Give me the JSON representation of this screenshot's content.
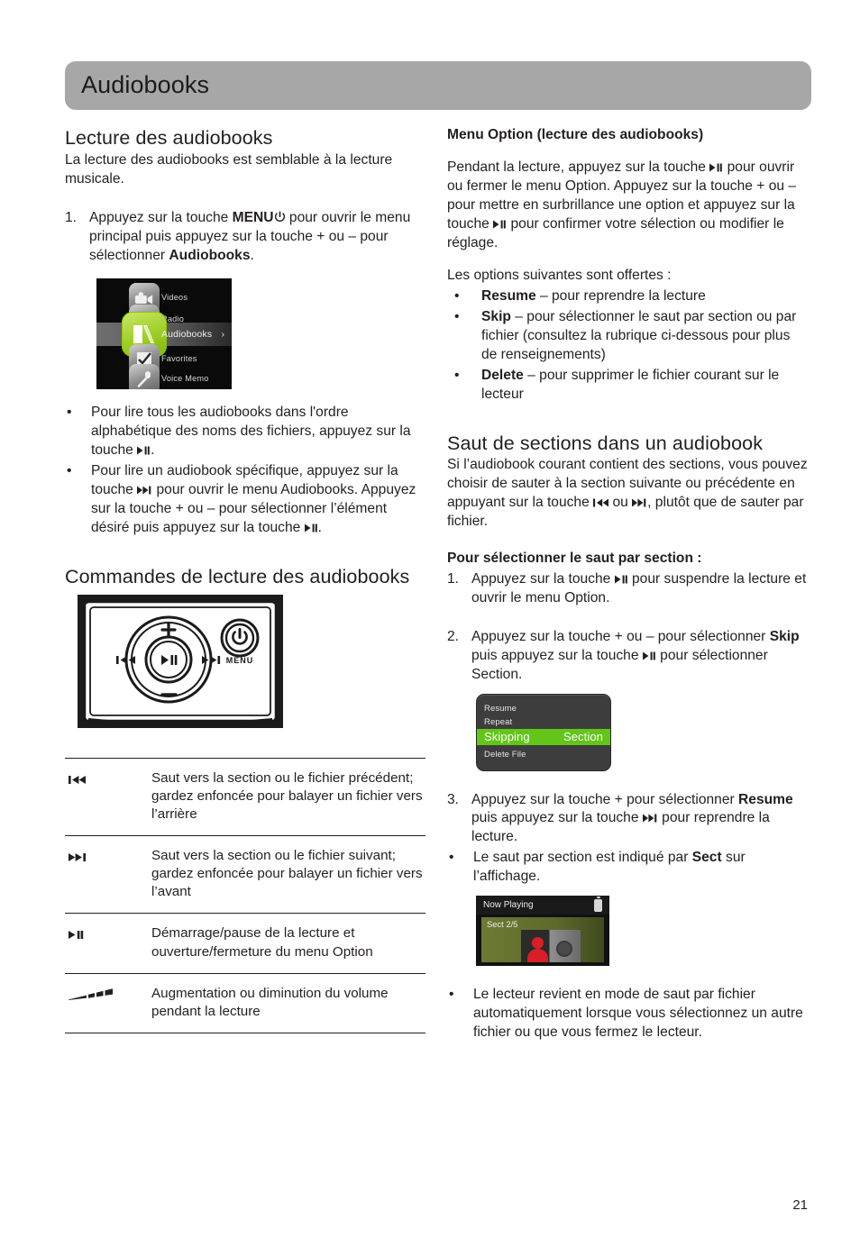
{
  "header": {
    "title": "Audiobooks",
    "bar_color": "#a7a7a7"
  },
  "left_column": {
    "section1": {
      "heading": "Lecture des audiobooks",
      "intro": "La lecture des audiobooks est semblable à la lecture musicale.",
      "step1_num": "1.",
      "step1_a": "Appuyez sur la touche ",
      "step1_menu": "MENU",
      "step1_b": " pour ouvrir le menu principal puis appuyez sur la touche + ou – pour sélectionner ",
      "step1_bold": "Audiobooks",
      "step1_c": ".",
      "bullet1_a": "Pour lire tous les audiobooks dans l'ordre alphabétique des noms des fichiers, appuyez sur la touche ",
      "bullet1_b": ".",
      "bullet2_a": "Pour lire un audiobook spécifique, appuyez sur la touche ",
      "bullet2_b": " pour ouvrir le menu Audiobooks. Appuyez sur la touche + ou – pour sélectionner l’élément désiré puis appuyez sur la touche ",
      "bullet2_c": ".",
      "bullet_mark": "•"
    },
    "device_menu_screenshot": {
      "items": [
        {
          "label": "Videos",
          "selected": false,
          "icon": "camcorder-icon"
        },
        {
          "label": "Radio",
          "selected": false,
          "icon": "radio-icon"
        },
        {
          "label": "Audiobooks",
          "selected": true,
          "icon": "book-icon",
          "chevron": "›"
        },
        {
          "label": "Favorites",
          "selected": false,
          "icon": "checkbox-icon"
        },
        {
          "label": "Voice Memo",
          "selected": false,
          "icon": "microphone-icon"
        }
      ],
      "highlight_color": "#9ccc2e"
    },
    "section2": {
      "heading": "Commandes de lecture des audiobooks",
      "pad_labels": {
        "plus": "+",
        "minus": "–",
        "menu": "MENU"
      },
      "table": [
        {
          "key_icon": "skip-back-icon",
          "desc": "Saut vers la section ou le fichier précédent; gardez enfoncée pour balayer un fichier vers l’arrière"
        },
        {
          "key_icon": "skip-forward-icon",
          "desc": "Saut vers la section ou le fichier suivant; gardez enfoncée pour balayer un fichier vers l’avant"
        },
        {
          "key_icon": "play-pause-icon",
          "desc": "Démarrage/pause de la lecture et ouverture/fermeture du menu Option"
        },
        {
          "key_icon": "volume-icon",
          "desc": "Augmentation ou diminution du volume pendant la lecture"
        }
      ]
    }
  },
  "right_column": {
    "option_menu": {
      "heading": "Menu Option (lecture des audiobooks)",
      "para_a": "Pendant la lecture, appuyez sur la touche ",
      "para_b": " pour ouvrir ou fermer le menu Option. Appuyez sur la touche + ou – pour mettre en surbrillance une option et appuyez sur la touche ",
      "para_c": " pour confirmer votre sélection ou modifier le réglage.",
      "options_intro": "Les options suivantes sont offertes :",
      "bullet_mark": "•",
      "options": [
        {
          "name": "Resume",
          "desc": " – pour reprendre la lecture"
        },
        {
          "name": "Skip ",
          "desc": " – pour sélectionner le saut par section ou par fichier (consultez la rubrique ci-dessous pour plus de renseignements)"
        },
        {
          "name": "Delete",
          "desc": " – pour supprimer le fichier courant sur le lecteur"
        }
      ]
    },
    "section_skip": {
      "heading": "Saut de sections dans un audiobook",
      "para_a": "Si l’audiobook courant contient des sections, vous pouvez choisir de sauter à la section suivante ou précédente en appuyant sur la touche ",
      "para_mid": " ou ",
      "para_c": ", plutôt que de sauter par fichier.",
      "sub_heading": "Pour sélectionner le saut par section :",
      "step1_num": "1.",
      "step1_a": "Appuyez sur la touche ",
      "step1_b": " pour suspendre la lecture et ouvrir le menu Option.",
      "step2_num": "2.",
      "step2_a": "Appuyez sur la touche + ou – pour sélectionner ",
      "step2_bold": "Skip",
      "step2_b": " puis appuyez sur la touche ",
      "step2_c": " pour sélectionner Section.",
      "step3_num": "3.",
      "step3_a": "Appuyez sur la touche + pour sélectionner ",
      "step3_bold": "Resume",
      "step3_b": " puis appuyez sur la touche ",
      "step3_c": "  pour reprendre la lecture.",
      "bullet_mark": "•",
      "bullet1_a": "Le saut par section est indiqué par ",
      "bullet1_bold": "Sect",
      "bullet1_b": " sur l’affichage.",
      "bullet2": "Le lecteur revient en mode de saut par fichier automatiquement lorsque vous sélectionnez un autre fichier ou que vous fermez le lecteur."
    },
    "option_screenshot": {
      "rows": [
        {
          "label": "Resume",
          "value": "",
          "highlighted": false
        },
        {
          "label": "Repeat",
          "value": "",
          "highlighted": false
        },
        {
          "label": "Skipping",
          "value": "Section",
          "highlighted": true
        },
        {
          "label": "Delete File",
          "value": "",
          "highlighted": false
        }
      ],
      "highlight_color": "#63c519"
    },
    "now_playing_screenshot": {
      "title": "Now Playing",
      "section_label": "Sect 2/5",
      "battery_icon": "battery-icon"
    }
  },
  "footer": {
    "page_number": "21"
  }
}
